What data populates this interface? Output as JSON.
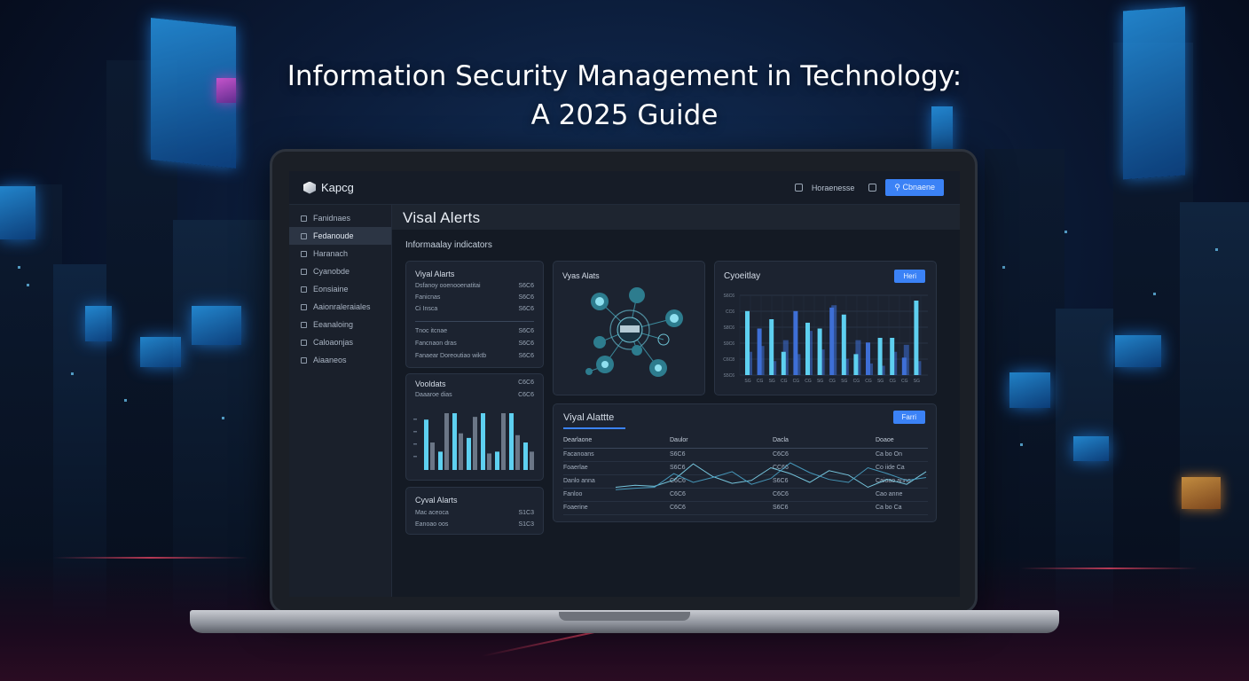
{
  "headline": {
    "line1": "Information Security Management in Technology:",
    "line2": "A 2025 Guide"
  },
  "app": {
    "brand": "Kapcg",
    "top_link": "Horaenesse",
    "top_button": "Cbnaene"
  },
  "sidebar": {
    "items": [
      {
        "label": "Fanidnaes",
        "active": false
      },
      {
        "label": "Fedanoude",
        "active": true
      },
      {
        "label": "Haranach",
        "active": false
      },
      {
        "label": "Cyanobde",
        "active": false
      },
      {
        "label": "Eonsiaine",
        "active": false
      },
      {
        "label": "Aaionraleraiales",
        "active": false
      },
      {
        "label": "Eeanaloing",
        "active": false
      },
      {
        "label": "Caloaonjas",
        "active": false
      },
      {
        "label": "Aiaaneos",
        "active": false
      }
    ]
  },
  "page": {
    "title": "Visal Alerts",
    "subtitle": "Informaalay indicators"
  },
  "card_alerts": {
    "title": "Viyal Alarts",
    "rows_top": [
      {
        "label": "Dsfanoy ooenooenatitai",
        "value": "S6C6"
      },
      {
        "label": "Fanicnas",
        "value": "S6C6"
      },
      {
        "label": "Ci Insca",
        "value": "S6C6"
      }
    ],
    "rows_bottom": [
      {
        "label": "Tnoc itcnae",
        "value": "S6C6"
      },
      {
        "label": "Fancnaon dras",
        "value": "S6C6"
      },
      {
        "label": "Fanaear Doreoutiao wiktb",
        "value": "S6C6"
      }
    ]
  },
  "card_vooldats": {
    "title": "Vooldats",
    "title_value": "C6C6",
    "sub_label": "Daaaroe dias",
    "sub_value": "C6C6",
    "chart_data": {
      "type": "bar",
      "series": [
        {
          "values": [
            55,
            20,
            62,
            35,
            62,
            20,
            62,
            30
          ]
        },
        {
          "values": [
            30,
            62,
            40,
            58,
            18,
            62,
            38,
            20
          ]
        }
      ]
    }
  },
  "card_cyval": {
    "title": "Cyval Alarts",
    "rows": [
      {
        "label": "Mac aceoca",
        "value": "S1C3"
      },
      {
        "label": "Eanoao oos",
        "value": "S1C3"
      }
    ]
  },
  "card_network": {
    "title": "Vyas Alats"
  },
  "card_cyber": {
    "title": "Cyoeitlay",
    "button": "Heri",
    "chart_data": {
      "type": "bar",
      "y_ticks": [
        "S6C6",
        "CC6",
        "S8C6",
        "S9C6",
        "C6C8",
        "S5C6"
      ],
      "categories": [
        "SG",
        "CG",
        "SG",
        "CG",
        "CG",
        "CG",
        "SG",
        "CG",
        "SG",
        "CG",
        "CG",
        "SG",
        "CG",
        "CG",
        "SG"
      ],
      "series": [
        {
          "name": "primary",
          "values": [
            55,
            40,
            48,
            20,
            55,
            45,
            40,
            58,
            52,
            18,
            28,
            32,
            32,
            15,
            64
          ]
        },
        {
          "name": "secondary",
          "values": [
            20,
            25,
            12,
            30,
            18,
            38,
            22,
            60,
            14,
            30,
            10,
            8,
            20,
            26,
            12
          ]
        }
      ]
    }
  },
  "card_table": {
    "title": "Viyal Alattte",
    "button": "Farri",
    "headers": [
      "Dearlaone",
      "Daulor",
      "Dacla",
      "Doaoe"
    ],
    "rows": [
      [
        "Facanoans",
        "S6C6",
        "C6C6",
        "Ca bo On"
      ],
      [
        "Foaerlae",
        "S6C6",
        "CC66",
        "Co iide Ca"
      ],
      [
        "Danlo anna",
        "C6C6",
        "S6C6",
        "Caioao anno"
      ],
      [
        "Fanloo",
        "C6C6",
        "C6C6",
        "Cao anne"
      ],
      [
        "Foaerine",
        "C6C6",
        "S6C6",
        "Ca bo Ca"
      ]
    ],
    "chart_data": {
      "type": "line",
      "series": [
        {
          "values": [
            30,
            34,
            32,
            45,
            78,
            52,
            38,
            44,
            70,
            58,
            40,
            64,
            55,
            30,
            46,
            36,
            62
          ]
        },
        {
          "values": [
            25,
            28,
            30,
            58,
            40,
            50,
            62,
            36,
            48,
            80,
            60,
            46,
            40,
            70,
            58,
            44,
            50
          ]
        }
      ]
    }
  },
  "colors": {
    "accent": "#3b82f6",
    "bar_cyan": "#5ed0f0",
    "bar_blue": "#3e6fd6",
    "bar_gray": "#6b7686",
    "node_teal": "#2d7c8e"
  }
}
